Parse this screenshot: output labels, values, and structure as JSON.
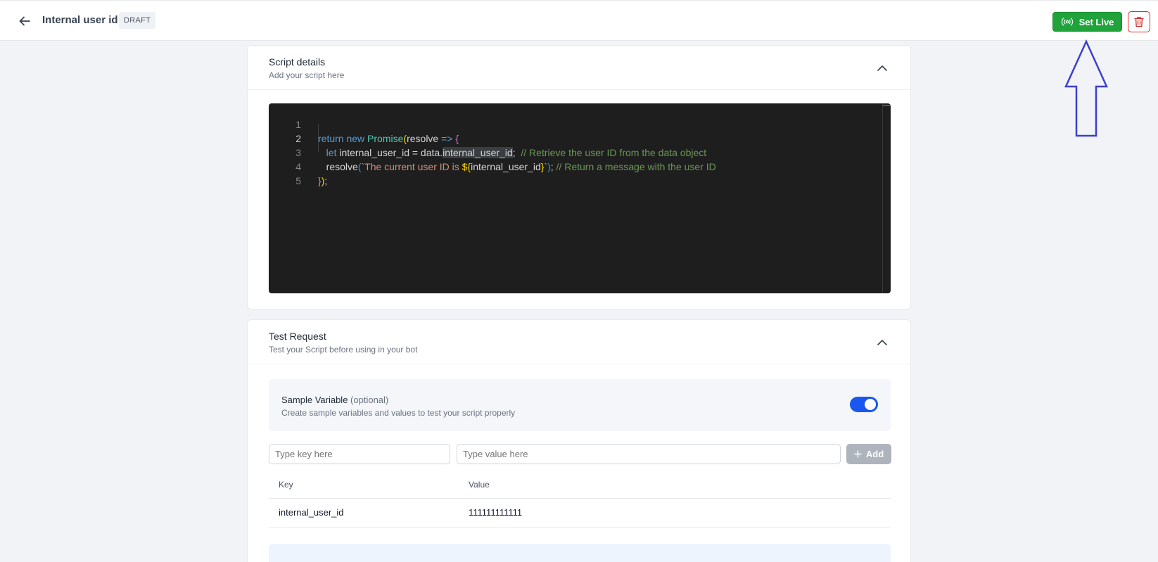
{
  "header": {
    "title": "Internal user id",
    "status": "DRAFT",
    "set_live_label": "Set Live",
    "icons": {
      "back": "arrow-left-icon",
      "live": "broadcast-icon",
      "delete": "trash-icon"
    }
  },
  "script_card": {
    "title": "Script details",
    "subtitle": "Add your script here",
    "code_lines": [
      "return new Promise(resolve => {",
      "  let internal_user_id = data.internal_user_id;  // Retrieve the user ID from the data object",
      "  resolve(`The current user ID is ${internal_user_id}`); // Return a message with the user ID",
      "});",
      ""
    ],
    "line_numbers": [
      "1",
      "2",
      "3",
      "4",
      "5"
    ]
  },
  "test_card": {
    "title": "Test Request",
    "subtitle": "Test your Script before using in your bot",
    "sample_variable": {
      "title": "Sample Variable",
      "optional": "(optional)",
      "description": "Create sample variables and values to test your script properly",
      "enabled": true
    },
    "key_placeholder": "Type key here",
    "value_placeholder": "Type value here",
    "add_label": "Add",
    "table": {
      "columns": [
        "Key",
        "Value"
      ],
      "rows": [
        {
          "key": "internal_user_id",
          "value": "111111111111"
        }
      ]
    }
  },
  "colors": {
    "accent_green": "#1fa33a",
    "danger_red": "#dc2626",
    "toggle_blue": "#1a56f0",
    "annotation_arrow": "#3b3fd1"
  }
}
